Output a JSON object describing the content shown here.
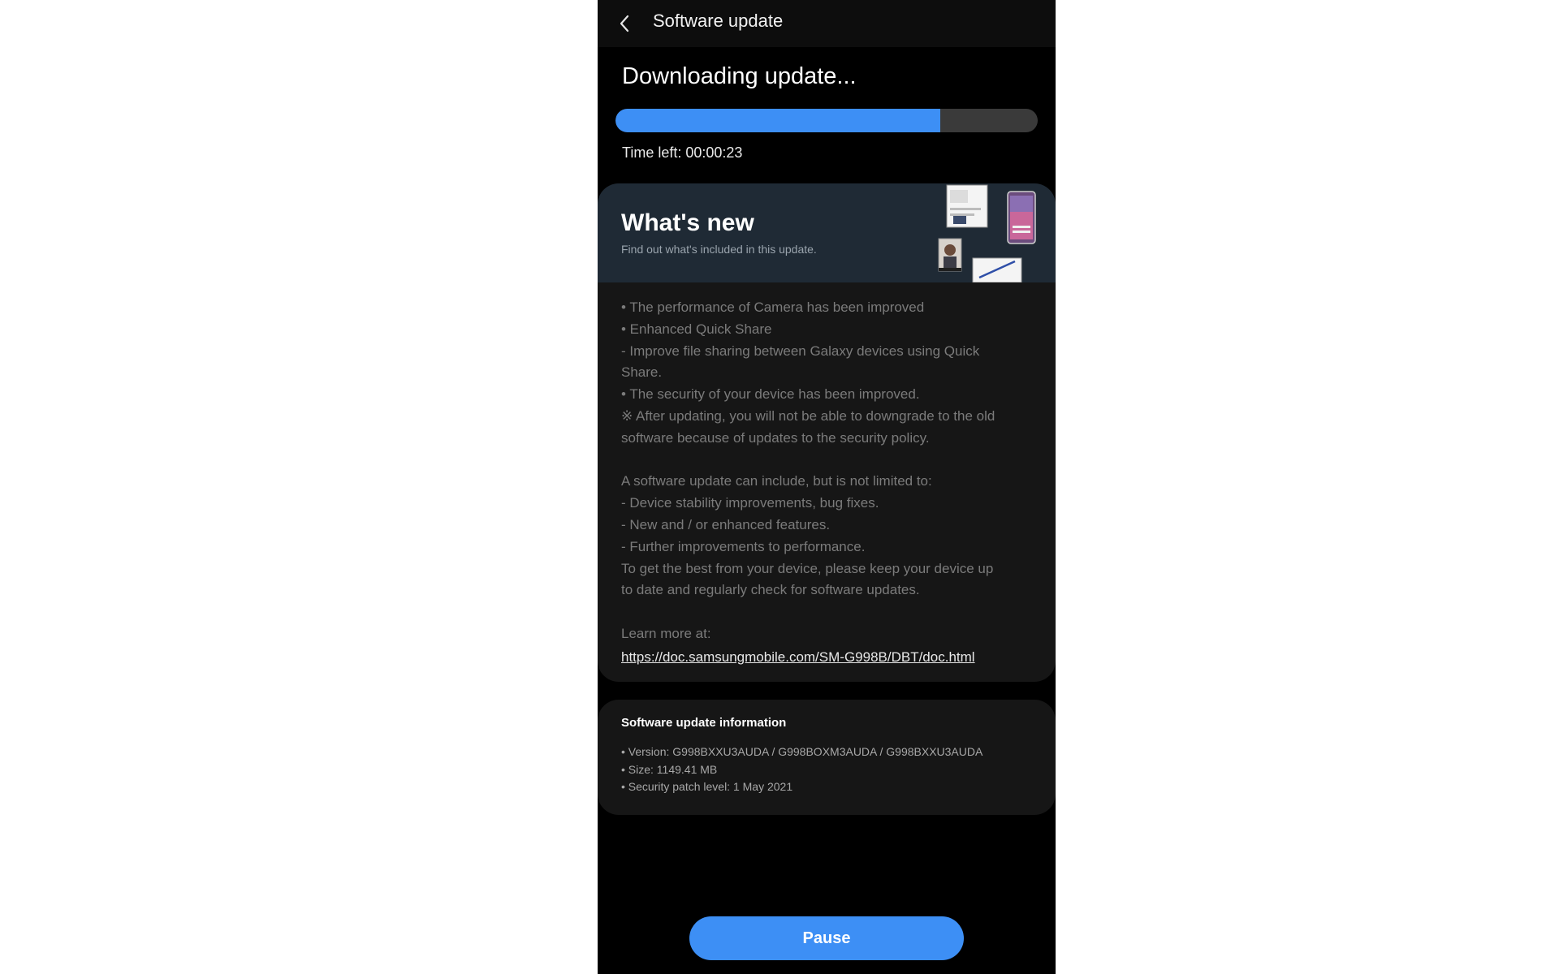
{
  "header": {
    "title": "Software update",
    "back_icon": "chevron-left-icon"
  },
  "download": {
    "title": "Downloading update...",
    "progress_percent": 77,
    "time_left": "Time left: 00:00:23"
  },
  "whats_new": {
    "title": "What's new",
    "subtitle": "Find out what's included in this update.",
    "notes": [
      "• The performance of Camera has been improved",
      "• Enhanced Quick Share",
      " - Improve file sharing between Galaxy devices using Quick",
      "Share.",
      "• The security of your device has been improved.",
      "※ After updating, you will not be able to downgrade to the old",
      "software because of updates to the security policy.",
      "",
      "A software update can include, but is not limited to:",
      " - Device stability improvements, bug fixes.",
      " - New and / or enhanced features.",
      " - Further improvements to performance.",
      "To get the best from your device, please keep your device up",
      "to date and regularly check for software updates.",
      "",
      "Learn more at:"
    ],
    "link": "https://doc.samsungmobile.com/SM-G998B/DBT/doc.html"
  },
  "info": {
    "title": "Software update information",
    "version": "• Version: G998BXXU3AUDA / G998BOXM3AUDA / G998BXXU3AUDA",
    "size": "• Size: 1149.41 MB",
    "security_patch": "• Security patch level: 1 May 2021"
  },
  "pause_button": {
    "label": "Pause"
  },
  "colors": {
    "accent": "#3d8ff5",
    "background": "#000000",
    "card": "#161616",
    "header_card": "#1f2a35"
  }
}
